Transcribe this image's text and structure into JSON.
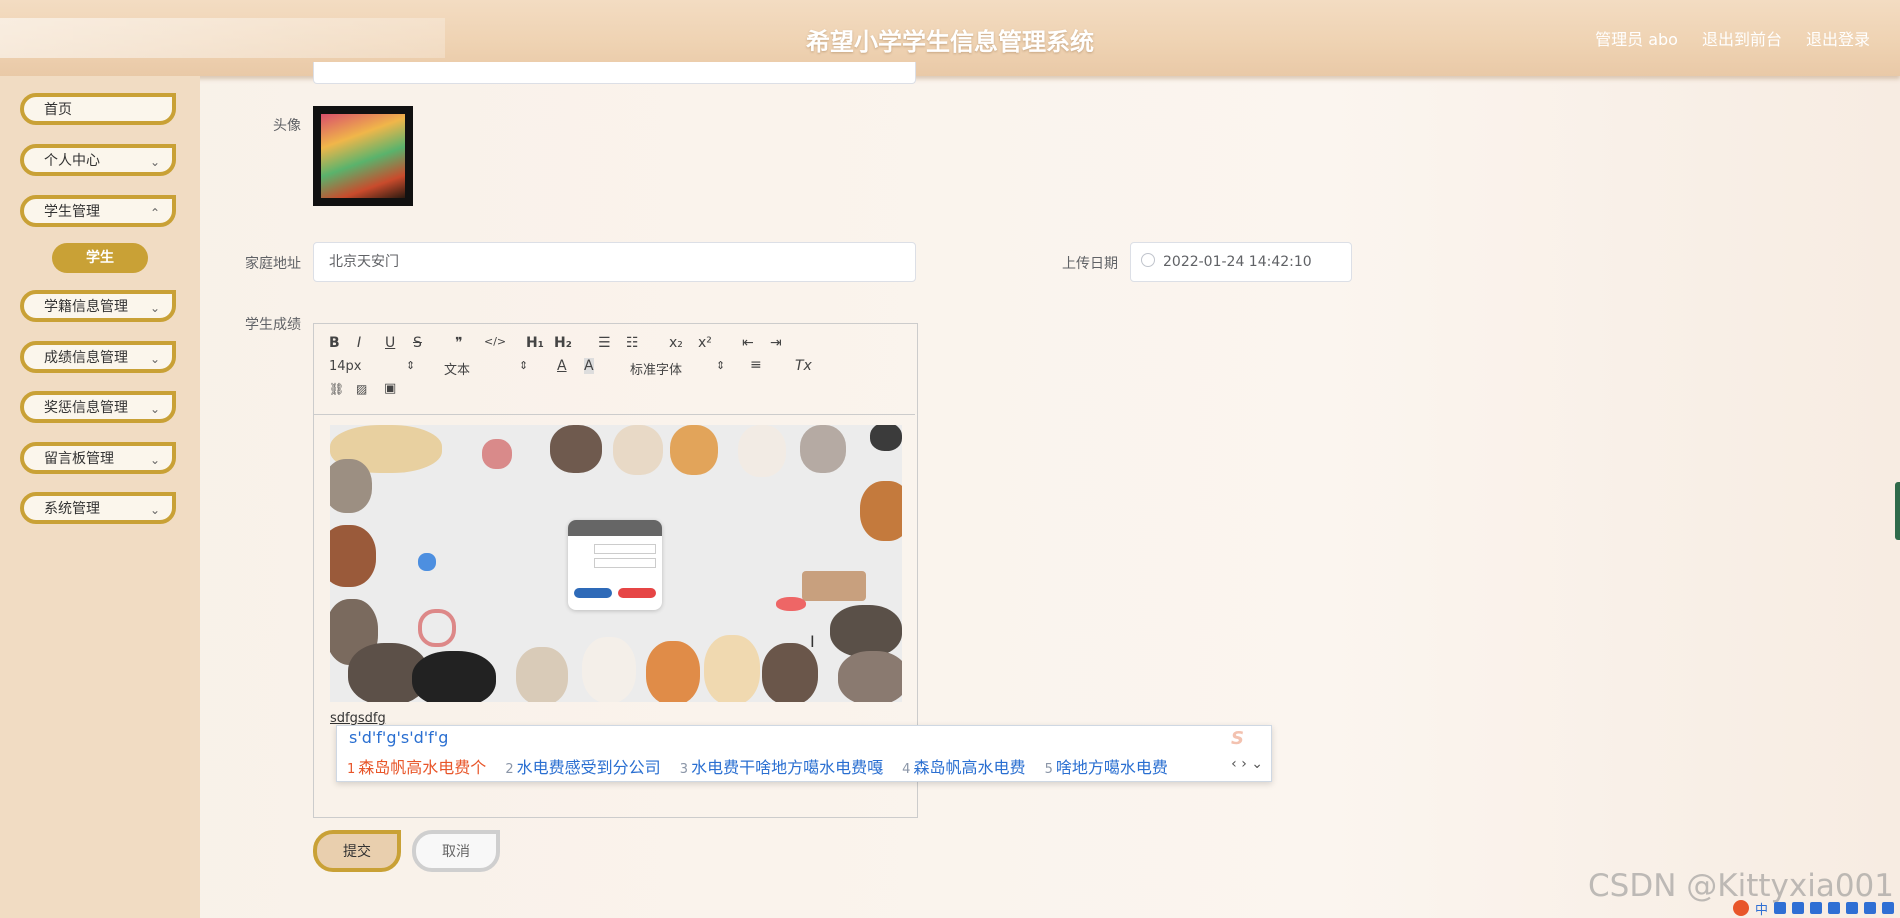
{
  "header": {
    "title": "希望小学学生信息管理系统",
    "admin": "管理员 abo",
    "front": "退出到前台",
    "logout": "退出登录"
  },
  "sidebar": {
    "items": [
      {
        "label": "首页"
      },
      {
        "label": "个人中心"
      },
      {
        "label": "学生管理"
      },
      {
        "label": "学籍信息管理"
      },
      {
        "label": "成绩信息管理"
      },
      {
        "label": "奖惩信息管理"
      },
      {
        "label": "留言板管理"
      },
      {
        "label": "系统管理"
      }
    ],
    "sub_item": "学生"
  },
  "form": {
    "avatar_label": "头像",
    "address_label": "家庭地址",
    "address_value": "北京天安门",
    "date_label": "上传日期",
    "date_value": "2022-01-24 14:42:10",
    "scores_label": "学生成绩"
  },
  "editor": {
    "toolbar": {
      "bold": "B",
      "italic": "I",
      "underline": "U",
      "strike": "S",
      "quote": "❞",
      "code": "</>",
      "h1": "H₁",
      "h2": "H₂",
      "ol": "☰",
      "ul": "☷",
      "sub": "x₂",
      "sup": "x²",
      "outdent": "⇤",
      "indent": "⇥",
      "size": "14px",
      "header": "文本",
      "color": "A",
      "bg": "A",
      "font": "标准字体",
      "align": "≡",
      "clean": "Tx",
      "link": "🔗",
      "image": "🖼",
      "video": "▣"
    },
    "content_text": "sdfgsdfg"
  },
  "ime": {
    "composition": "s'd'f'g's'd'f'g",
    "candidates": [
      {
        "n": "1",
        "text": "森岛帆高水电费个"
      },
      {
        "n": "2",
        "text": "水电费感受到分公司"
      },
      {
        "n": "3",
        "text": "水电费干啥地方噶水电费嘎"
      },
      {
        "n": "4",
        "text": "森岛帆高水电费"
      },
      {
        "n": "5",
        "text": "啥地方噶水电费"
      }
    ],
    "arrows": "‹ › ⌄"
  },
  "buttons": {
    "submit": "提交",
    "cancel": "取消"
  },
  "watermark": "CSDN @Kittyxia001",
  "tray": {
    "zh": "中"
  }
}
